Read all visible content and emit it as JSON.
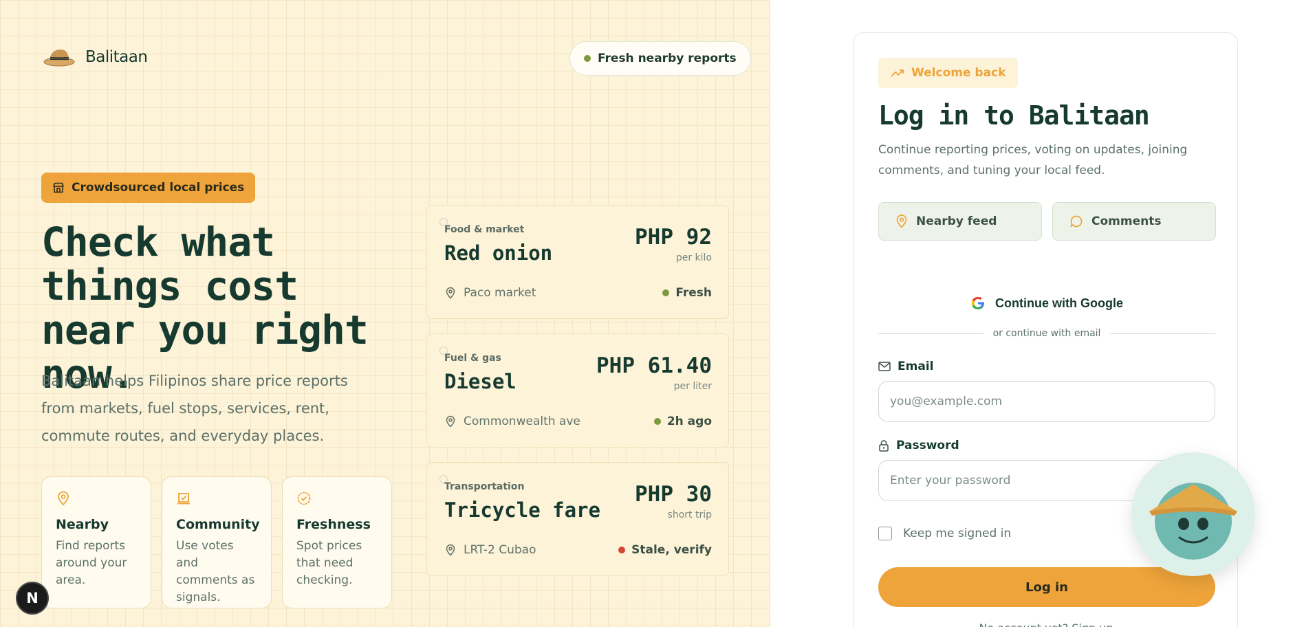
{
  "brand": {
    "name": "Balitaan",
    "logo_icon": "hat-logo-icon"
  },
  "header": {
    "status_pill": "Fresh nearby reports"
  },
  "hero": {
    "tag": "Crowdsourced local prices",
    "title": "Check what things cost near you right now.",
    "description": "Balitaan helps Filipinos share price reports from markets, fuel stops, services, rent, commute routes, and everyday places."
  },
  "features": [
    {
      "icon": "pin-icon",
      "title": "Nearby",
      "text": "Find reports around your area."
    },
    {
      "icon": "vote-icon",
      "title": "Community",
      "text": "Use votes and comments as signals."
    },
    {
      "icon": "badge-check-icon",
      "title": "Freshness",
      "text": "Spot prices that need checking."
    }
  ],
  "price_cards": [
    {
      "category": "Food & market",
      "name": "Red onion",
      "price": "PHP 92",
      "unit": "per kilo",
      "location": "Paco market",
      "status": "Fresh",
      "status_color": "#7c9a3d"
    },
    {
      "category": "Fuel & gas",
      "name": "Diesel",
      "price": "PHP 61.40",
      "unit": "per liter",
      "location": "Commonwealth ave",
      "status": "2h ago",
      "status_color": "#7c9a3d"
    },
    {
      "category": "Transportation",
      "name": "Tricycle fare",
      "price": "PHP 30",
      "unit": "short trip",
      "location": "LRT-2 Cubao",
      "status": "Stale, verify",
      "status_color": "#d64532"
    }
  ],
  "badge": {
    "letter": "N"
  },
  "login": {
    "welcome": "Welcome back",
    "title": "Log in to Balitaan",
    "subtitle": "Continue reporting prices, voting on updates, joining comments, and tuning your local feed.",
    "chips": [
      "Nearby feed",
      "Comments"
    ],
    "google_label": "Continue with Google",
    "divider_text": "or continue with email",
    "email_label": "Email",
    "email_placeholder": "you@example.com",
    "password_label": "Password",
    "password_placeholder": "Enter your password",
    "remember_label": "Keep me signed in",
    "submit_label": "Log in",
    "footer_text": "No account yet? Sign up"
  },
  "colors": {
    "accent": "#eea43a",
    "ink": "#163a2f",
    "cream": "#fdf3d9",
    "fresh": "#7c9a3d",
    "stale": "#d64532"
  }
}
